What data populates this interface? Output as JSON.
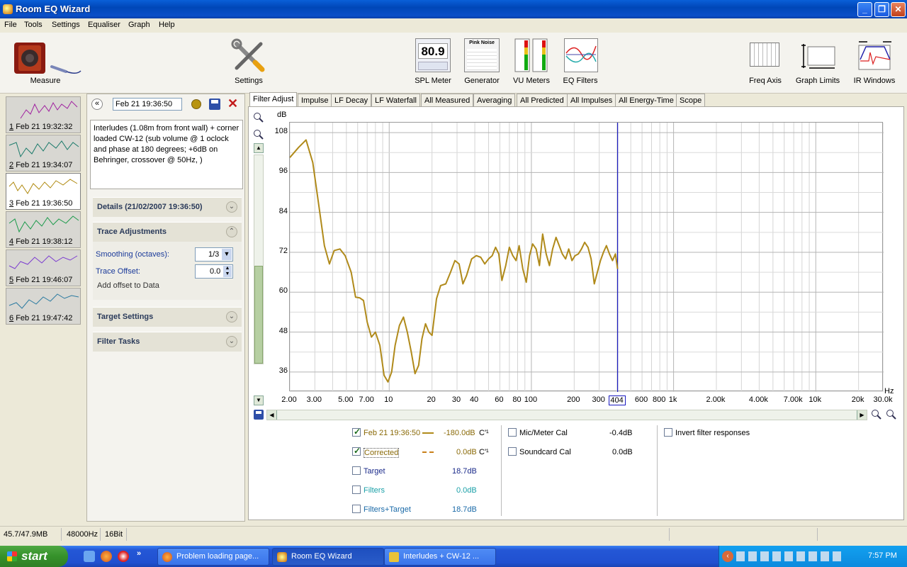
{
  "window": {
    "title": "Room EQ Wizard"
  },
  "menu": [
    "File",
    "Tools",
    "Settings",
    "Equaliser",
    "Graph",
    "Help"
  ],
  "toolbar": {
    "measure": "Measure",
    "settings": "Settings",
    "spl_meter": "SPL Meter",
    "spl_value": "80.9",
    "generator": "Generator",
    "generator_mode": "Pink Noise",
    "vu_meters": "VU Meters",
    "eq_filters": "EQ Filters",
    "freq_axis": "Freq Axis",
    "graph_limits": "Graph Limits",
    "ir_windows": "IR Windows"
  },
  "measurements": [
    {
      "num": "1",
      "label": "Feb 21 19:32:32",
      "color": "#a020a0"
    },
    {
      "num": "2",
      "label": "Feb 21 19:34:07",
      "color": "#1a7a6a"
    },
    {
      "num": "3",
      "label": "Feb 21 19:36:50",
      "color": "#b08a10"
    },
    {
      "num": "4",
      "label": "Feb 21 19:38:12",
      "color": "#1a9a4a"
    },
    {
      "num": "5",
      "label": "Feb 21 19:46:07",
      "color": "#7a3ad0"
    },
    {
      "num": "6",
      "label": "Feb 21 19:47:42",
      "color": "#2a7aa0"
    }
  ],
  "panel": {
    "name_value": "Feb 21 19:36:50",
    "notes": "Interludes (1.08m from front wall) + corner loaded CW-12 (sub volume @ 1 oclock and phase at 180 degrees; +6dB on Behringer, crossover @ 50Hz, )",
    "details": "Details  (21/02/2007 19:36:50)",
    "trace_adjustments": "Trace Adjustments",
    "smoothing_label": "Smoothing (octaves):",
    "smoothing_value": "1/3",
    "offset_label": "Trace Offset:",
    "offset_value": "0.0",
    "add_offset": "Add offset to Data",
    "target_settings": "Target Settings",
    "filter_tasks": "Filter Tasks"
  },
  "tabs": [
    "Filter Adjust",
    "Impulse",
    "LF Decay",
    "LF Waterfall",
    "All Measured",
    "Averaging",
    "All Predicted",
    "All Impulses",
    "All Energy-Time",
    "Scope"
  ],
  "chart_data": {
    "type": "line",
    "ylabel": "dB",
    "xlabel": "Hz",
    "ylim": [
      30,
      111
    ],
    "xlim": [
      2.0,
      30000
    ],
    "xscale": "log",
    "yticks": [
      "108",
      "96",
      "84",
      "72",
      "60",
      "48",
      "36"
    ],
    "xticks": [
      "2.00",
      "3.00",
      "5.00",
      "7.00",
      "10",
      "20",
      "30",
      "40",
      "60",
      "80",
      "100",
      "200",
      "300",
      "404",
      "600",
      "800",
      "1k",
      "2.00k",
      "4.00k",
      "7.00k",
      "10k",
      "20k",
      "30.0k"
    ],
    "cursor_x": 404,
    "grid": true,
    "series": [
      {
        "name": "Feb 21 19:36:50",
        "color": "#b08a1a",
        "x": [
          2.0,
          2.3,
          2.6,
          2.9,
          3.2,
          3.5,
          3.8,
          4.1,
          4.5,
          4.9,
          5.4,
          5.8,
          6.2,
          6.6,
          7.0,
          7.5,
          8.0,
          8.6,
          9.2,
          9.8,
          10.4,
          11.0,
          11.8,
          12.6,
          13.4,
          14.3,
          15.2,
          16.1,
          17.0,
          18.0,
          19.0,
          20.0,
          21.5,
          23,
          25,
          27,
          29,
          31,
          33,
          35,
          38,
          41,
          44,
          47,
          50,
          53,
          56,
          59,
          62,
          66,
          70,
          74,
          78,
          82,
          87,
          92,
          97,
          102,
          108,
          114,
          120,
          127,
          134,
          141,
          149,
          157,
          165,
          174,
          183,
          193,
          203,
          214,
          225,
          237,
          250,
          263,
          277,
          291,
          306,
          321,
          337,
          354,
          372,
          390,
          404
        ],
        "values": [
          100.5,
          103.5,
          105.8,
          99,
          86,
          74,
          68.5,
          72.5,
          73,
          71,
          66,
          58.5,
          58.3,
          57.5,
          51,
          46.5,
          48,
          44,
          35,
          33,
          36,
          44,
          50,
          52.5,
          48,
          42,
          35.5,
          38,
          46,
          50.5,
          48,
          47,
          58,
          62,
          62.5,
          66,
          69.5,
          68.5,
          62.5,
          65,
          70,
          71,
          70.5,
          68.5,
          70,
          71,
          73.5,
          71.5,
          63.5,
          68,
          73.5,
          71,
          69.5,
          74,
          67,
          63,
          71,
          74.5,
          73,
          68,
          77.5,
          71.5,
          68,
          73,
          76.5,
          74,
          71.5,
          70,
          73,
          69.5,
          71,
          71.5,
          73,
          75,
          73.5,
          70,
          62.5,
          66,
          69.5,
          72,
          74,
          71.5,
          69.5,
          71.5,
          67
        ]
      }
    ]
  },
  "legend": {
    "trace_name": "Feb 21 19:36:50",
    "trace_value": "-180.0dB",
    "trace_unit": "C'¹",
    "corrected": "Corrected",
    "corrected_value": "0.0dB",
    "corrected_unit": "C'¹",
    "target": "Target",
    "target_value": "18.7dB",
    "filters": "Filters",
    "filters_value": "0.0dB",
    "filters_target": "Filters+Target",
    "filters_target_value": "18.7dB",
    "mic_cal": "Mic/Meter Cal",
    "mic_cal_value": "-0.4dB",
    "soundcard_cal": "Soundcard Cal",
    "soundcard_cal_value": "0.0dB",
    "invert": "Invert filter responses"
  },
  "status": {
    "memory": "45.7/47.9MB",
    "rate": "48000Hz",
    "bits": "16Bit"
  },
  "taskbar": {
    "start": "start",
    "tasks": [
      "Problem loading page...",
      "Room EQ Wizard",
      "Interludes + CW-12 ..."
    ],
    "clock": "7:57 PM"
  }
}
